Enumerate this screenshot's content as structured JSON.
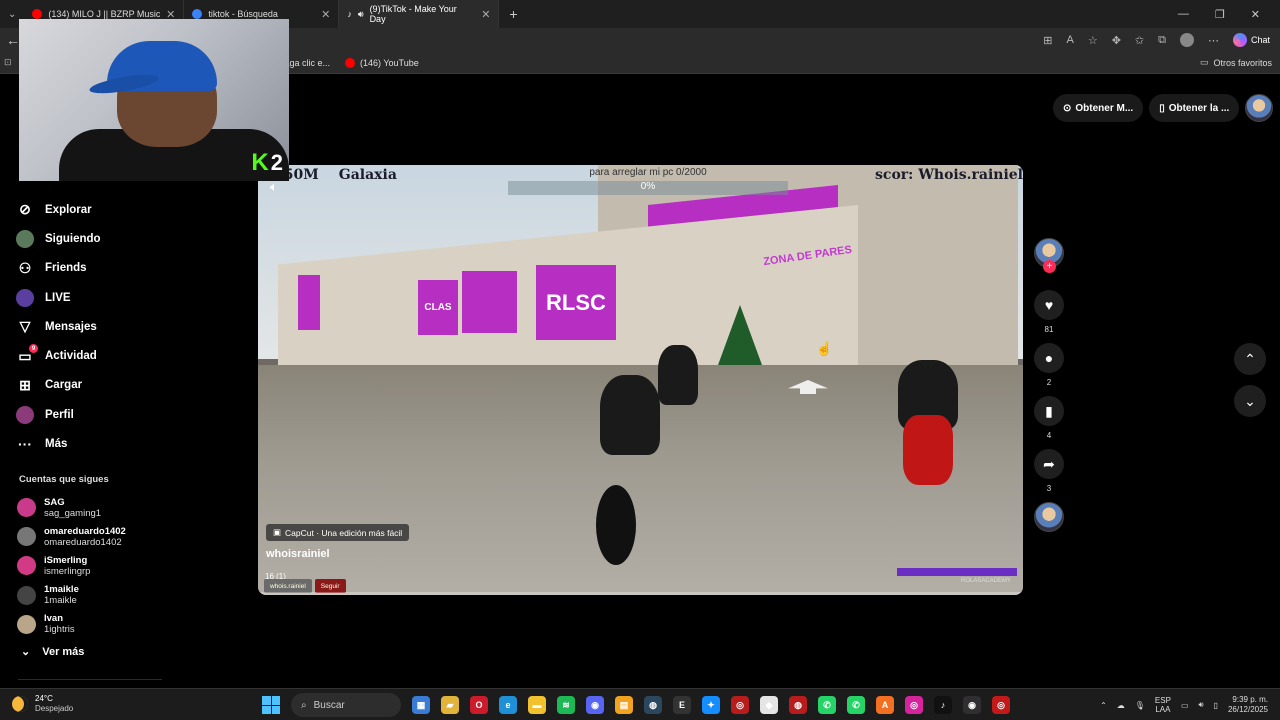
{
  "browser": {
    "tabs": [
      {
        "title": "(134) MILO J || BZRP Music Sessions",
        "icon": "youtube-icon",
        "color": "#ff0000"
      },
      {
        "title": "tiktok - Búsqueda",
        "icon": "search-icon",
        "color": "#3b82f6"
      },
      {
        "title": "(9)TikTok - Make Your Day",
        "icon": "tiktok-icon",
        "color": "#ffffff"
      }
    ],
    "new_tab": "+",
    "chat_label": "Chat",
    "bookmarks": [
      {
        "label": "Haga clic e...",
        "icon": "bookmark-icon"
      },
      {
        "label": "(146) YouTube",
        "icon": "youtube-icon"
      }
    ],
    "other_favorites": "Otros favoritos"
  },
  "overlay": {
    "kick_letter": "K",
    "kick_count": "2"
  },
  "sidebar": {
    "items": [
      {
        "label": "Explorar",
        "icon": "compass-icon",
        "glyph": "⊘"
      },
      {
        "label": "Siguiendo",
        "icon": "following-avatar-icon",
        "glyph": "●"
      },
      {
        "label": "Friends",
        "icon": "friends-icon",
        "glyph": "⚇"
      },
      {
        "label": "LIVE",
        "icon": "live-icon",
        "glyph": "●"
      },
      {
        "label": "Mensajes",
        "icon": "messages-icon",
        "glyph": "▽"
      },
      {
        "label": "Actividad",
        "icon": "activity-icon",
        "glyph": "▭",
        "badge": "9"
      },
      {
        "label": "Cargar",
        "icon": "upload-icon",
        "glyph": "⊞"
      },
      {
        "label": "Perfil",
        "icon": "profile-avatar-icon",
        "glyph": "●"
      },
      {
        "label": "Más",
        "icon": "more-icon",
        "glyph": "···"
      }
    ],
    "following_title": "Cuentas que sigues",
    "following": [
      {
        "name": "SAG",
        "user": "sag_gaming1",
        "color": "#c93a8a"
      },
      {
        "name": "omareduardo1402",
        "user": "omareduardo1402",
        "color": "#777777"
      },
      {
        "name": "iSmerling",
        "user": "ismerlingrp",
        "color": "#d23a86"
      },
      {
        "name": "1maikle",
        "user": "1maikle",
        "color": "#444444"
      },
      {
        "name": "Ivan",
        "user": "1ightris",
        "color": "#b9a58a"
      }
    ],
    "see_more": "Ver más"
  },
  "top_actions": {
    "coins": "Obtener M...",
    "app": "Obtener la ..."
  },
  "video": {
    "hud_money": "250M",
    "hud_location": "Galaxia",
    "hud_goal": "para arreglar mi pc  0/2000",
    "hud_percent": "0%",
    "hud_right": "scor: Whois.rainiel",
    "wall_sign_1": "RLSC",
    "wall_sign_2": "CLAS",
    "zone_text": "ZONA DE PARES",
    "capcut": "CapCut · Una edición más fácil",
    "author": "whoisrainiel",
    "stream_count": "16 (1)",
    "chip_1": "whois.rainiel",
    "chip_2": "Seguir",
    "academy": "ROLASACADEMY"
  },
  "actions": {
    "likes": "81",
    "comments": "2",
    "saves": "4",
    "shares": "3"
  },
  "taskbar": {
    "temp": "24°C",
    "weather": "Despejado",
    "search": "Buscar",
    "lang_1": "ESP",
    "lang_2": "LAA",
    "time": "9:39 p. m.",
    "date": "26/12/2025",
    "apps": [
      {
        "name": "widgets-icon",
        "color": "#3a7bd5",
        "glyph": "▦"
      },
      {
        "name": "file-explorer-icon",
        "color": "#e0b43a",
        "glyph": "▰"
      },
      {
        "name": "opera-icon",
        "color": "#cc1b2a",
        "glyph": "O"
      },
      {
        "name": "edge-icon",
        "color": "#1f8fd6",
        "glyph": "e"
      },
      {
        "name": "folder-icon",
        "color": "#f2c12e",
        "glyph": "▬"
      },
      {
        "name": "spotify-icon",
        "color": "#1db954",
        "glyph": "≋"
      },
      {
        "name": "discord-icon",
        "color": "#5865f2",
        "glyph": "◉"
      },
      {
        "name": "notes-icon",
        "color": "#f1a21f",
        "glyph": "▤"
      },
      {
        "name": "steam-icon",
        "color": "#2a475e",
        "glyph": "◍"
      },
      {
        "name": "epic-icon",
        "color": "#333333",
        "glyph": "E"
      },
      {
        "name": "battle-net-icon",
        "color": "#148eff",
        "glyph": "✦"
      },
      {
        "name": "game-app-icon",
        "color": "#b91c1c",
        "glyph": "◎"
      },
      {
        "name": "roblox-icon",
        "color": "#e5e5e5",
        "glyph": "◆"
      },
      {
        "name": "rockstar-icon",
        "color": "#b91c1c",
        "glyph": "◍"
      },
      {
        "name": "whatsapp-icon",
        "color": "#25d366",
        "glyph": "✆"
      },
      {
        "name": "whatsapp-business-icon",
        "color": "#25d366",
        "glyph": "✆"
      },
      {
        "name": "adobe-icon",
        "color": "#f36f21",
        "glyph": "A"
      },
      {
        "name": "instagram-icon",
        "color": "#d6249f",
        "glyph": "◎"
      },
      {
        "name": "tiktok-icon",
        "color": "#111111",
        "glyph": "♪"
      },
      {
        "name": "obs-icon",
        "color": "#302e31",
        "glyph": "◉"
      },
      {
        "name": "app-red-icon",
        "color": "#c21a1a",
        "glyph": "◎"
      }
    ]
  }
}
